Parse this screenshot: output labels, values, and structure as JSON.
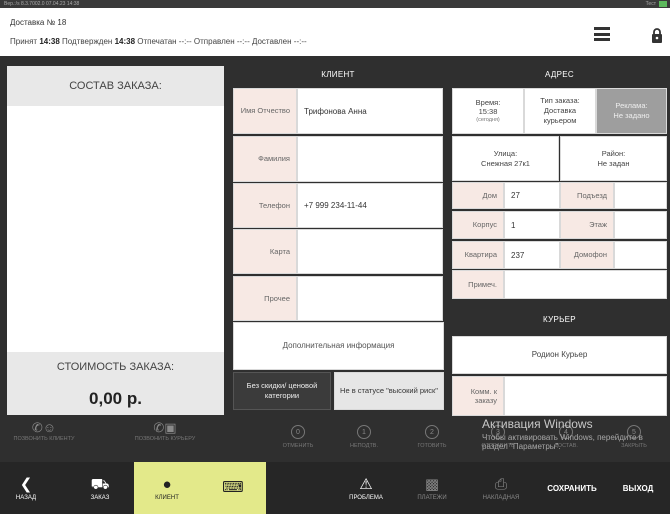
{
  "status_strip": {
    "left": "Вер.:/s 8.3.7002.0 07.04.23 14:38",
    "right": "Тест"
  },
  "header": {
    "title": "Доставка № 18",
    "accepted_label": "Принят",
    "accepted_time": "14:38",
    "confirmed_label": "Подтвержден",
    "confirmed_time": "14:38",
    "printed": "Отпечатан --:--",
    "sent": "Отправлен --:--",
    "delivered": "Доставлен --:--"
  },
  "order": {
    "composition_title": "СОСТАВ ЗАКАЗА:",
    "cost_title": "СТОИМОСТЬ ЗАКАЗА:",
    "cost_value": "0,00 р."
  },
  "client": {
    "title": "КЛИЕНТ",
    "name_label": "Имя Отчество",
    "name_value": "Трифонова Анна",
    "surname_label": "Фамилия",
    "surname_value": "",
    "phone_label": "Телефон",
    "phone_value": "+7 999 234-11-44",
    "card_label": "Карта",
    "card_value": "",
    "other_label": "Прочее",
    "other_value": "",
    "additional_info": "Дополнительная информация",
    "no_discount": "Без скидки/ ценовой категории",
    "risk": "Не в статусе \"высокий риск\""
  },
  "address": {
    "title": "АДРЕС",
    "time_label": "Время:",
    "time_value": "15:38",
    "time_note": "(сегодня)",
    "order_type_label": "Тип заказа:",
    "order_type_value": "Доставка курьером",
    "ad_label": "Реклама:",
    "ad_value": "Не задано",
    "street_label": "Улица:",
    "street_value": "Снежная 27к1",
    "district_label": "Район:",
    "district_value": "Не задан",
    "house_label": "Дом",
    "house_value": "27",
    "entrance_label": "Подъезд",
    "entrance_value": "",
    "building_label": "Корпус",
    "building_value": "1",
    "floor_label": "Этаж",
    "floor_value": "",
    "apt_label": "Квартира",
    "apt_value": "237",
    "intercom_label": "Домофон",
    "intercom_value": "",
    "note_label": "Примеч.",
    "note_value": ""
  },
  "courier": {
    "title": "КУРЬЕР",
    "name": "Родион Курьер",
    "comment_label": "Комм. к заказу"
  },
  "actions": {
    "call_client": "ПОЗВОНИТЬ КЛИЕНТУ",
    "call_courier": "ПОЗВОНИТЬ КУРЬЕРУ",
    "cancel": "ОТМЕНИТЬ",
    "cancel_num": "0",
    "unconfirm": "НЕПОДТВ.",
    "unconfirm_num": "1",
    "ready": "ГОТОВИТЬ",
    "ready_num": "2",
    "send": "ОТПРАВИТЬ",
    "send_num": "3",
    "delivered": "ДОСТАВ.",
    "delivered_num": "4",
    "close": "ЗАКРЫТЬ",
    "close_num": "5"
  },
  "watermark": {
    "line1": "Активация Windows",
    "line2": "Чтобы активировать Windows, перейдите в раздел \"Параметры\"."
  },
  "nav": {
    "back": "НАЗАД",
    "order": "ЗАКАЗ",
    "client": "КЛИЕНТ",
    "problem": "ПРОБЛЕМА",
    "payments": "ПЛАТЕЖИ",
    "invoice": "НАКЛАДНАЯ",
    "save": "СОХРАНИТЬ",
    "exit": "ВЫХОД"
  },
  "colors": {
    "accent_yellow": "#e3e98a",
    "dark_bg": "#2f2f2f",
    "label_bg": "#f7e9e4",
    "ad_gray": "#9e9e9e"
  }
}
